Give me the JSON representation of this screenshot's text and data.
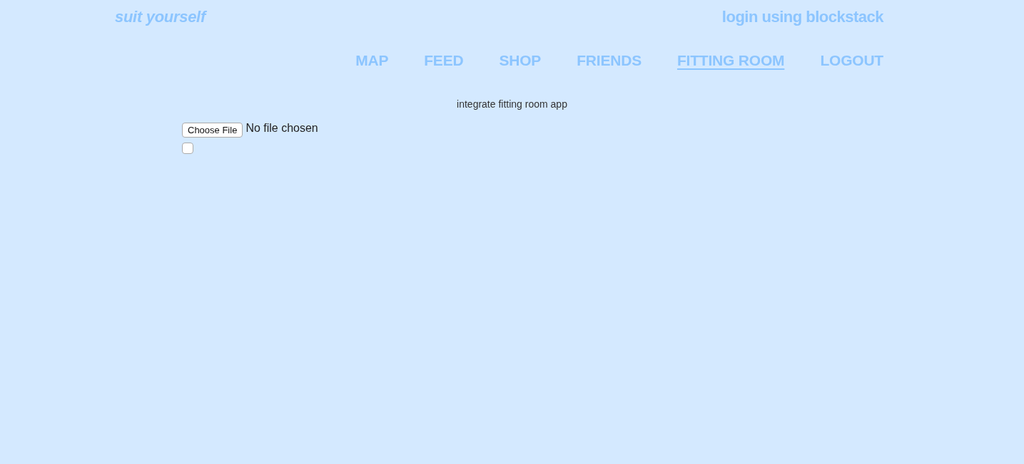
{
  "header": {
    "logo": "suit yourself",
    "login_link": "login using blockstack"
  },
  "nav": [
    {
      "label": "MAP",
      "selected": false
    },
    {
      "label": "FEED",
      "selected": false
    },
    {
      "label": "SHOP",
      "selected": false
    },
    {
      "label": "FRIENDS",
      "selected": false
    },
    {
      "label": "FITTING ROOM",
      "selected": true
    },
    {
      "label": "LOGOUT",
      "selected": false
    }
  ],
  "content": {
    "heading": "integrate fitting room app",
    "file_input": {
      "button_label": "Choose File",
      "status_text": "No file chosen"
    },
    "checkbox": {
      "checked": false
    }
  }
}
